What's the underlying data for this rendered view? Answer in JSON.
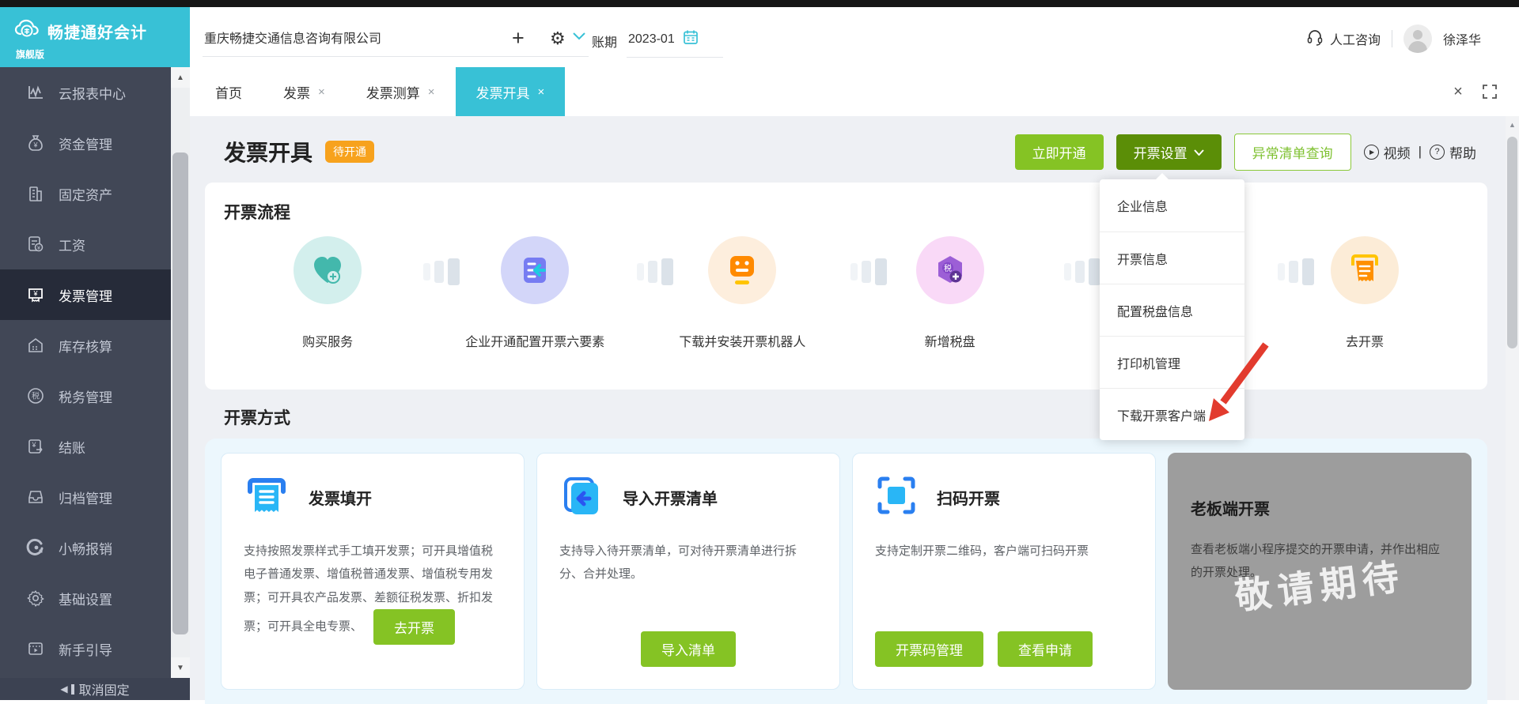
{
  "topbar": {
    "logo_title": "畅捷通好会计",
    "logo_sub": "旗舰版",
    "company": "重庆畅捷交通信息咨询有限公司",
    "period_label": "账期",
    "period_value": "2023-01",
    "support": "人工咨询",
    "user": "徐泽华"
  },
  "icons": {
    "plus": "+",
    "gear": "⚙",
    "close": "×",
    "play": "▶",
    "help": "?",
    "scroll_up": "▲",
    "scroll_down": "▼",
    "unpin_tri": "◀"
  },
  "tabs": [
    {
      "label": "首页",
      "closable": false,
      "active": false
    },
    {
      "label": "发票",
      "closable": true,
      "active": false
    },
    {
      "label": "发票测算",
      "closable": true,
      "active": false
    },
    {
      "label": "发票开具",
      "closable": true,
      "active": true
    }
  ],
  "sidebar": {
    "items": [
      {
        "label": "云报表中心"
      },
      {
        "label": "资金管理"
      },
      {
        "label": "固定资产"
      },
      {
        "label": "工资"
      },
      {
        "label": "发票管理",
        "active": true
      },
      {
        "label": "库存核算"
      },
      {
        "label": "税务管理"
      },
      {
        "label": "结账"
      },
      {
        "label": "归档管理"
      },
      {
        "label": "小畅报销"
      },
      {
        "label": "基础设置"
      },
      {
        "label": "新手引导"
      }
    ],
    "unpin": "取消固定"
  },
  "page": {
    "title": "发票开具",
    "badge": "待开通",
    "btn_activate": "立即开通",
    "btn_settings": "开票设置",
    "btn_abnormal": "异常清单查询",
    "video": "视频",
    "help": "帮助"
  },
  "dropdown": {
    "items": [
      {
        "label": "企业信息"
      },
      {
        "label": "开票信息"
      },
      {
        "label": "配置税盘信息"
      },
      {
        "label": "打印机管理"
      },
      {
        "label": "下载开票客户端"
      }
    ]
  },
  "flow": {
    "title": "开票流程",
    "steps": [
      {
        "label": "购买服务"
      },
      {
        "label": "企业开通配置开票六要素"
      },
      {
        "label": "下载并安装开票机器人"
      },
      {
        "label": "新增税盘"
      },
      {
        "label": ""
      },
      {
        "label": "去开票"
      }
    ]
  },
  "methods": {
    "title": "开票方式",
    "cards": [
      {
        "title": "发票填开",
        "desc": "支持按照发票样式手工填开发票；可开具增值税电子普通发票、增值税普通发票、增值税专用发票；可开具农产品发票、差额征税发票、折扣发票；可开具全电专票、",
        "buttons": [
          "去开票"
        ]
      },
      {
        "title": "导入开票清单",
        "desc": "支持导入待开票清单，可对待开票清单进行拆分、合并处理。",
        "buttons": [
          "导入清单"
        ]
      },
      {
        "title": "扫码开票",
        "desc": "支持定制开票二维码，客户端可扫码开票",
        "buttons": [
          "开票码管理",
          "查看申请"
        ]
      },
      {
        "title": "老板端开票",
        "desc": "查看老板端小程序提交的开票申请，并作出相应的开票处理。",
        "watermark": "敬请期待",
        "buttons": []
      }
    ]
  },
  "colors": {
    "accent_cyan": "#38c1d6",
    "primary_green": "#85c324",
    "dark_green": "#5b8e07",
    "badge_orange": "#f7a21d",
    "arrow_red": "#e23b2e",
    "sidebar_bg": "#414756",
    "sidebar_active": "#262b39"
  }
}
